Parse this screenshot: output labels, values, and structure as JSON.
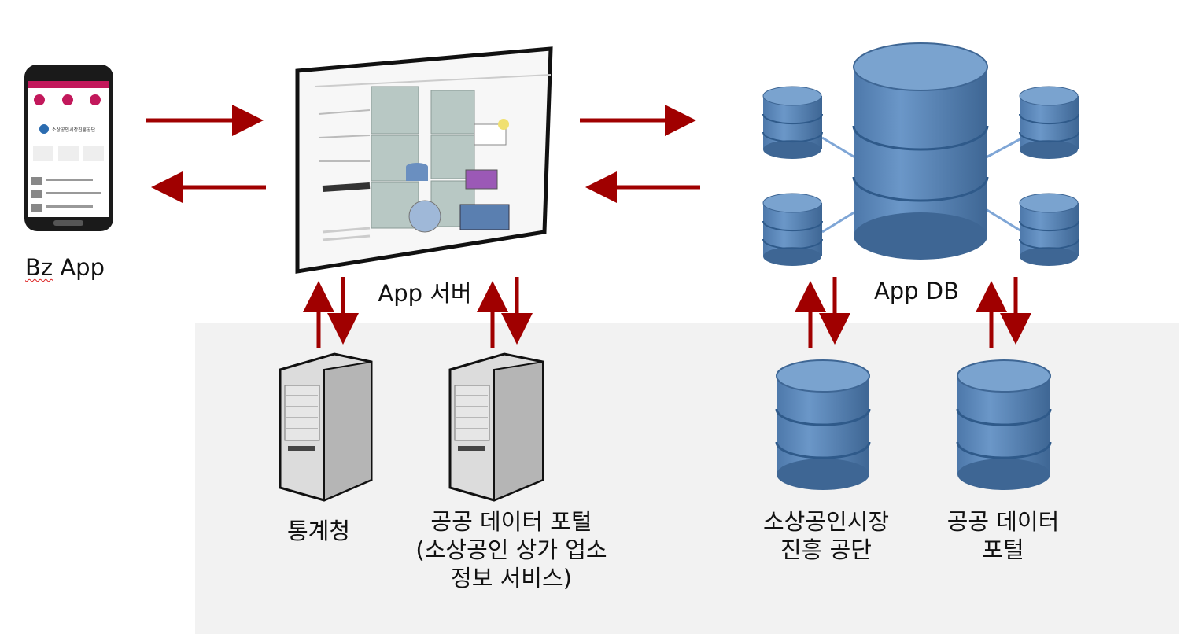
{
  "labels": {
    "bz_app_prefix": "Bz",
    "bz_app_suffix": " App",
    "app_server": "App 서버",
    "app_db": "App DB",
    "statistics_korea": "통계청",
    "public_data_portal_stores": "공공 데이터 포털\n(소상공인 상가 업소\n정보 서비스)",
    "semas": "소상공인시장\n진흥 공단",
    "public_data_portal": "공공 데이터\n포털"
  },
  "phone": {
    "brand": "소상공인시장진흥공단"
  },
  "colors": {
    "arrow": "#a00000",
    "panel": "#f2f2f2",
    "db_fill": "#5b86b8",
    "db_dark": "#3d6593",
    "db_light": "#7aa3cf"
  }
}
